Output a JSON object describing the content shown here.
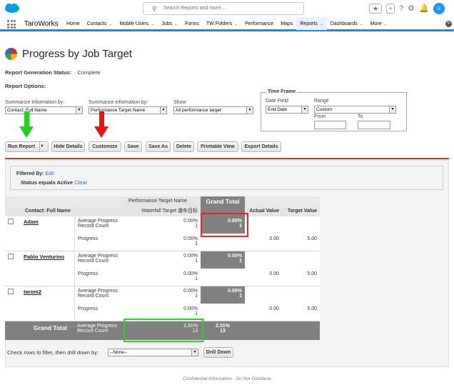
{
  "header": {
    "search_placeholder": "Search Reports and more...",
    "app_name": "TaroWorks",
    "nav_tabs": [
      {
        "label": "Home",
        "chevron": false
      },
      {
        "label": "Contacts",
        "chevron": true
      },
      {
        "label": "Mobile Users",
        "chevron": true
      },
      {
        "label": "Jobs",
        "chevron": true
      },
      {
        "label": "Forms",
        "chevron": false
      },
      {
        "label": "TW Folders",
        "chevron": true
      },
      {
        "label": "Performance",
        "chevron": false
      },
      {
        "label": "Maps",
        "chevron": false
      },
      {
        "label": "Reports",
        "chevron": true,
        "active": true
      },
      {
        "label": "Dashboards",
        "chevron": true
      },
      {
        "label": "More",
        "chevron": true
      }
    ],
    "icons": [
      "favorites-star-icon",
      "add-icon",
      "help-icon",
      "setup-gear-icon",
      "notifications-bell-icon",
      "user-avatar"
    ]
  },
  "page": {
    "title": "Progress by Job Target",
    "generation_status_label": "Report Generation Status:",
    "generation_status_value": "Complete",
    "report_options_label": "Report Options:"
  },
  "options": {
    "summarize1_label": "Summarize information by:",
    "summarize1_value": "Contact: Full Name",
    "summarize2_label": "Summarize information by:",
    "summarize2_value": "Performance Target Name",
    "show_label": "Show",
    "show_value": "All performance target",
    "timeframe_title": "Time Frame",
    "date_field_label": "Date Field",
    "date_field_value": "End Date",
    "range_label": "Range",
    "range_value": "Custom",
    "from_label": "From",
    "to_label": "To"
  },
  "buttons": {
    "run_report": "Run Report",
    "hide_details": "Hide Details",
    "customize": "Customize",
    "save": "Save",
    "save_as": "Save As",
    "delete": "Delete",
    "printable_view": "Printable View",
    "export_details": "Export Details",
    "drill_down": "Drill Down"
  },
  "filter": {
    "filtered_by": "Filtered By:",
    "edit": "Edit",
    "condition": "Status equals Active",
    "clear": "Clear"
  },
  "matrix": {
    "col_group_header": "Performance Target Name",
    "grand_total_header": "Grand Total",
    "contact_header": "Contact: Full Name",
    "target_header": "Waterfall Target 瀑布目标",
    "actual_header": "Actual Value",
    "target_value_header": "Target Value",
    "rows": [
      {
        "name": "Adam",
        "summary_label_1": "Average Progress",
        "summary_label_2": "Record Count",
        "target_pct": "0.00%",
        "target_count": "1",
        "grand_pct": "0.00%",
        "grand_count": "1",
        "detail_label": "Progress",
        "detail_pct": "0.00%",
        "detail_count": "1",
        "actual": "0.00",
        "target": "5.00"
      },
      {
        "name": "Pablo Venturino",
        "summary_label_1": "Average Progress",
        "summary_label_2": "Record Count",
        "target_pct": "0.00%",
        "target_count": "1",
        "grand_pct": "0.00%",
        "grand_count": "1",
        "detail_label": "Progress",
        "detail_pct": "0.00%",
        "detail_count": "1",
        "actual": "0.00",
        "target": "5.00"
      },
      {
        "name": "tarom2",
        "summary_label_1": "Average Progress",
        "summary_label_2": "Record Count",
        "target_pct": "0.00%",
        "target_count": "1",
        "grand_pct": "0.00%",
        "grand_count": "1",
        "detail_label": "Progress",
        "detail_pct": "0.00%",
        "detail_count": "1",
        "actual": "0.00",
        "target": "5.00"
      }
    ],
    "grand": {
      "label": "Grand Total",
      "summary_label_1": "Average Progress",
      "summary_label_2": "Record Count",
      "target_pct": "2.31%",
      "target_count": "13",
      "grand_pct": "2.31%",
      "grand_count": "13"
    }
  },
  "drill": {
    "label": "Check rows to filter, then drill down by:",
    "select_value": "--None--"
  },
  "footer": "Confidential Information - Do Not Distribute",
  "colors": {
    "brand": "#1589ee",
    "highlight_red": "#e8212a",
    "highlight_green": "#2cd22c",
    "arrow_green": "#1fd21f",
    "arrow_red": "#ee1111",
    "dark_cell": "#808080"
  }
}
